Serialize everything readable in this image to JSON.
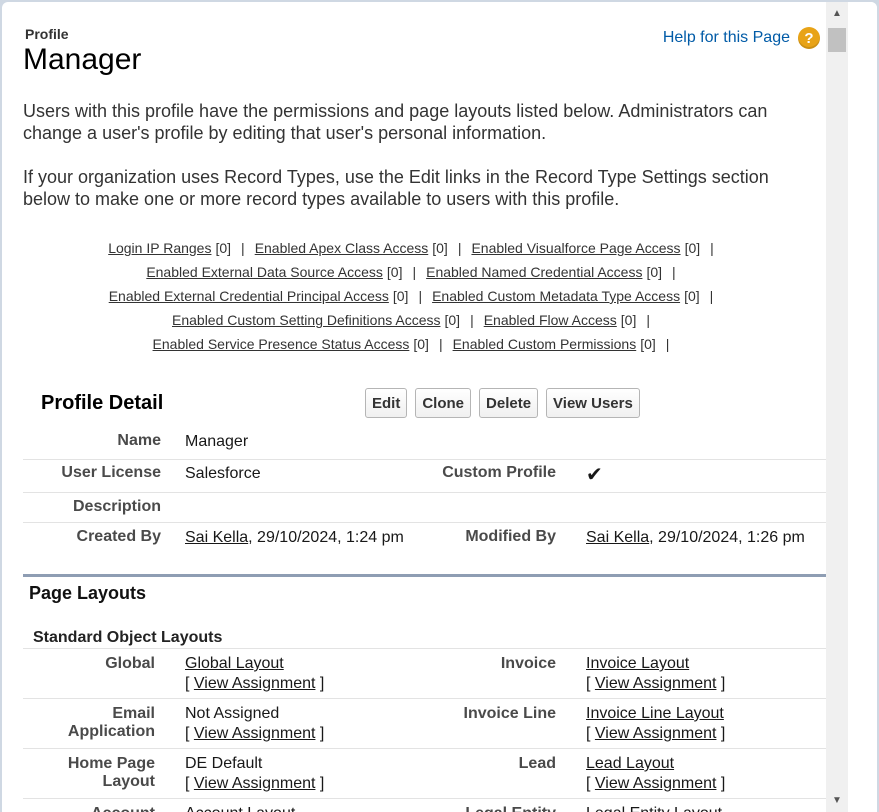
{
  "header": {
    "eyebrow": "Profile",
    "title": "Manager",
    "help_link": "Help for this Page",
    "help_icon": "?"
  },
  "intro": {
    "p1": "Users with this profile have the permissions and page layouts listed below. Administrators can change a user's profile by editing that user's personal information.",
    "p2": "If your organization uses Record Types, use the Edit links in the Record Type Settings section below to make one or more record types available to users with this profile."
  },
  "related_links": [
    [
      {
        "label": "Login IP Ranges",
        "count": "[0]"
      },
      {
        "label": "Enabled Apex Class Access",
        "count": "[0]"
      },
      {
        "label": "Enabled Visualforce Page Access",
        "count": "[0]"
      }
    ],
    [
      {
        "label": "Enabled External Data Source Access",
        "count": "[0]"
      },
      {
        "label": "Enabled Named Credential Access",
        "count": "[0]"
      }
    ],
    [
      {
        "label": "Enabled External Credential Principal Access",
        "count": "[0]"
      },
      {
        "label": "Enabled Custom Metadata Type Access",
        "count": "[0]"
      }
    ],
    [
      {
        "label": "Enabled Custom Setting Definitions Access",
        "count": "[0]"
      },
      {
        "label": "Enabled Flow Access",
        "count": "[0]"
      }
    ],
    [
      {
        "label": "Enabled Service Presence Status Access",
        "count": "[0]"
      },
      {
        "label": "Enabled Custom Permissions",
        "count": "[0]"
      }
    ]
  ],
  "detail": {
    "title": "Profile Detail",
    "buttons": {
      "edit": "Edit",
      "clone": "Clone",
      "delete": "Delete",
      "view_users": "View Users"
    },
    "name_label": "Name",
    "name_value": "Manager",
    "license_label": "User License",
    "license_value": "Salesforce",
    "custom_label": "Custom Profile",
    "custom_value": "✔",
    "description_label": "Description",
    "created_label": "Created By",
    "created_user": "Sai Kella",
    "created_date": ", 29/10/2024, 1:24 pm",
    "modified_label": "Modified By",
    "modified_user": "Sai Kella",
    "modified_date": ", 29/10/2024, 1:26 pm"
  },
  "layouts": {
    "section_title": "Page Layouts",
    "sub_title": "Standard Object Layouts",
    "view_assignment": "View Assignment",
    "rows": [
      {
        "left_label": "Global",
        "left_value": "Global Layout",
        "left_is_link": true,
        "right_label": "Invoice",
        "right_value": "Invoice Layout",
        "right_is_link": true
      },
      {
        "left_label": "Email Application",
        "left_value": "Not Assigned",
        "left_is_link": false,
        "right_label": "Invoice Line",
        "right_value": "Invoice Line Layout",
        "right_is_link": true
      },
      {
        "left_label": "Home Page Layout",
        "left_value": "DE Default",
        "left_is_link": false,
        "right_label": "Lead",
        "right_value": "Lead Layout",
        "right_is_link": true
      },
      {
        "left_label": "Account",
        "left_value": "Account Layout",
        "left_is_link": true,
        "right_label": "Legal Entity",
        "right_value": "Legal Entity Layout",
        "right_is_link": true
      }
    ]
  }
}
